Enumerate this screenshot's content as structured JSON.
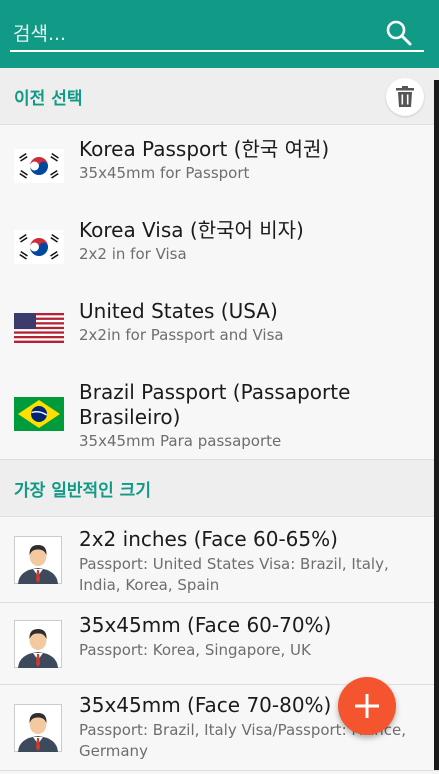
{
  "search": {
    "placeholder": "검색..."
  },
  "recent": {
    "title": "이전 선택",
    "items": [
      {
        "title": "Korea Passport (한국 여권)",
        "subtitle": "35x45mm for Passport",
        "icon": "flag-korea-icon"
      },
      {
        "title": "Korea Visa (한국어 비자)",
        "subtitle": "2x2 in for Visa",
        "icon": "flag-korea-icon"
      },
      {
        "title": "United States (USA)",
        "subtitle": "2x2in for Passport and Visa",
        "icon": "flag-usa-icon"
      },
      {
        "title": "Brazil Passport (Passaporte Brasileiro)",
        "subtitle": "35x45mm Para passaporte",
        "icon": "flag-brazil-icon"
      }
    ]
  },
  "common": {
    "title": "가장 일반적인 크기",
    "items": [
      {
        "title": "2x2 inches (Face 60-65%)",
        "subtitle": "Passport: United States Visa: Brazil, Italy, India, Korea, Spain",
        "icon": "person-portrait-icon"
      },
      {
        "title": "35x45mm (Face 60-70%)",
        "subtitle": "Passport: Korea, Singapore, UK",
        "icon": "person-portrait-icon"
      },
      {
        "title": "35x45mm (Face 70-80%)",
        "subtitle": "Passport: Brazil, Italy Visa/Passport: France, Germany",
        "icon": "person-portrait-icon"
      }
    ]
  },
  "colors": {
    "accent": "#119a86",
    "fab": "#f4552e"
  }
}
